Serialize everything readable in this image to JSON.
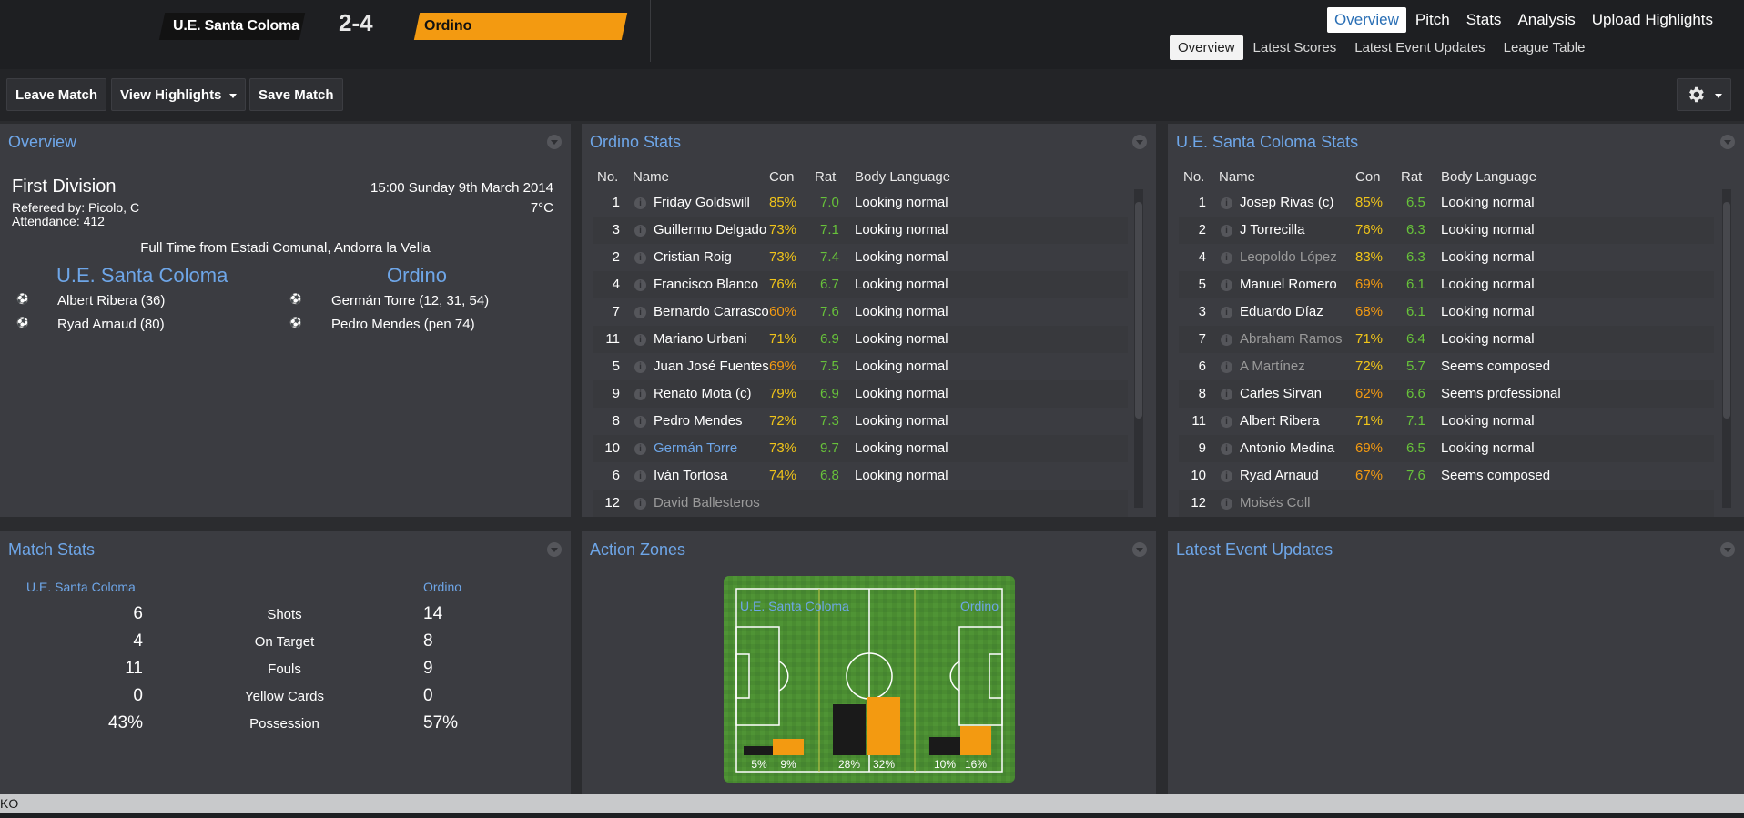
{
  "header": {
    "home_team": "U.E. Santa Coloma",
    "score": "2-4",
    "away_team": "Ordino",
    "away_color": "#f39a11",
    "main_tabs": [
      "Overview",
      "Pitch",
      "Stats",
      "Analysis",
      "Upload Highlights"
    ],
    "sub_tabs": [
      "Overview",
      "Latest Scores",
      "Latest Event Updates",
      "League Table"
    ]
  },
  "toolbar": {
    "leave": "Leave Match",
    "highlights": "View Highlights",
    "save": "Save Match",
    "gear_icon": "gear-icon"
  },
  "overview": {
    "title": "Overview",
    "competition": "First Division",
    "datetime": "15:00 Sunday 9th March 2014",
    "referee": "Refereed by: Picolo, C",
    "temperature": "7°C",
    "attendance": "Attendance: 412",
    "venue": "Full Time from Estadi Comunal, Andorra la Vella",
    "home": "U.E. Santa Coloma",
    "away": "Ordino",
    "home_scorers": [
      "Albert Ribera (36)",
      "Ryad Arnaud (80)"
    ],
    "away_scorers": [
      "Germán Torre (12, 31, 54)",
      "Pedro Mendes (pen 74)"
    ]
  },
  "ordino_stats": {
    "title": "Ordino Stats",
    "headers": [
      "No.",
      "Name",
      "Con",
      "Rat",
      "Body Language"
    ],
    "rows": [
      {
        "no": "1",
        "name": "Friday Goldswill",
        "con": "85%",
        "rat": "7.0",
        "body": "Looking normal",
        "con_c": "yellow"
      },
      {
        "no": "3",
        "name": "Guillermo Delgado",
        "con": "73%",
        "rat": "7.1",
        "body": "Looking normal",
        "con_c": "yellow"
      },
      {
        "no": "2",
        "name": "Cristian Roig",
        "con": "73%",
        "rat": "7.4",
        "body": "Looking normal",
        "con_c": "yellow"
      },
      {
        "no": "4",
        "name": "Francisco Blanco",
        "con": "76%",
        "rat": "6.7",
        "body": "Looking normal",
        "con_c": "yellow"
      },
      {
        "no": "7",
        "name": "Bernardo Carrasco",
        "con": "60%",
        "rat": "7.6",
        "body": "Looking normal",
        "con_c": "orange"
      },
      {
        "no": "11",
        "name": "Mariano Urbani",
        "con": "71%",
        "rat": "6.9",
        "body": "Looking normal",
        "con_c": "yellow"
      },
      {
        "no": "5",
        "name": "Juan José Fuentes",
        "con": "69%",
        "rat": "7.5",
        "body": "Looking normal",
        "con_c": "orange"
      },
      {
        "no": "9",
        "name": "Renato Mota (c)",
        "con": "79%",
        "rat": "6.9",
        "body": "Looking normal",
        "con_c": "yellow"
      },
      {
        "no": "8",
        "name": "Pedro Mendes",
        "con": "72%",
        "rat": "7.3",
        "body": "Looking normal",
        "con_c": "yellow"
      },
      {
        "no": "10",
        "name": "Germán Torre",
        "con": "73%",
        "rat": "9.7",
        "body": "Looking normal",
        "con_c": "yellow",
        "name_c": "blue"
      },
      {
        "no": "6",
        "name": "Iván Tortosa",
        "con": "74%",
        "rat": "6.8",
        "body": "Looking normal",
        "con_c": "yellow"
      },
      {
        "no": "12",
        "name": "David Ballesteros",
        "con": "",
        "rat": "",
        "body": "",
        "name_c": "dim"
      }
    ]
  },
  "usc_stats": {
    "title": "U.E. Santa Coloma Stats",
    "headers": [
      "No.",
      "Name",
      "Con",
      "Rat",
      "Body Language"
    ],
    "rows": [
      {
        "no": "1",
        "name": "Josep Rivas (c)",
        "con": "85%",
        "rat": "6.5",
        "body": "Looking normal",
        "con_c": "yellow"
      },
      {
        "no": "2",
        "name": "J Torrecilla",
        "con": "76%",
        "rat": "6.3",
        "body": "Looking normal",
        "con_c": "yellow"
      },
      {
        "no": "4",
        "name": "Leopoldo López",
        "con": "83%",
        "rat": "6.3",
        "body": "Looking normal",
        "con_c": "yellow",
        "name_c": "dim"
      },
      {
        "no": "5",
        "name": "Manuel Romero",
        "con": "69%",
        "rat": "6.1",
        "body": "Looking normal",
        "con_c": "orange"
      },
      {
        "no": "3",
        "name": "Eduardo Díaz",
        "con": "68%",
        "rat": "6.1",
        "body": "Looking normal",
        "con_c": "orange"
      },
      {
        "no": "7",
        "name": "Abraham Ramos",
        "con": "71%",
        "rat": "6.4",
        "body": "Looking normal",
        "con_c": "yellow",
        "name_c": "dim"
      },
      {
        "no": "6",
        "name": "A Martínez",
        "con": "72%",
        "rat": "5.7",
        "body": "Seems composed",
        "con_c": "yellow",
        "name_c": "dim"
      },
      {
        "no": "8",
        "name": "Carles Sirvan",
        "con": "62%",
        "rat": "6.6",
        "body": "Seems professional",
        "con_c": "orange"
      },
      {
        "no": "11",
        "name": "Albert Ribera",
        "con": "71%",
        "rat": "7.1",
        "body": "Looking normal",
        "con_c": "yellow"
      },
      {
        "no": "9",
        "name": "Antonio Medina",
        "con": "69%",
        "rat": "6.5",
        "body": "Looking normal",
        "con_c": "orange"
      },
      {
        "no": "10",
        "name": "Ryad Arnaud",
        "con": "67%",
        "rat": "7.6",
        "body": "Seems composed",
        "con_c": "orange"
      },
      {
        "no": "12",
        "name": "Moisés Coll",
        "con": "",
        "rat": "",
        "body": "",
        "name_c": "dim"
      }
    ]
  },
  "match_stats": {
    "title": "Match Stats",
    "home": "U.E. Santa Coloma",
    "away": "Ordino",
    "rows": [
      {
        "label": "Shots",
        "home": "6",
        "away": "14"
      },
      {
        "label": "On Target",
        "home": "4",
        "away": "8"
      },
      {
        "label": "Fouls",
        "home": "11",
        "away": "9"
      },
      {
        "label": "Yellow Cards",
        "home": "0",
        "away": "0"
      },
      {
        "label": "Possession",
        "home": "43%",
        "away": "57%"
      }
    ]
  },
  "action_zones": {
    "title": "Action Zones",
    "home_label": "U.E. Santa Coloma",
    "away_label": "Ordino",
    "zones": [
      {
        "home": 5,
        "away": 9,
        "home_label": "5%",
        "away_label": "9%"
      },
      {
        "home": 28,
        "away": 32,
        "home_label": "28%",
        "away_label": "32%"
      },
      {
        "home": 10,
        "away": 16,
        "home_label": "10%",
        "away_label": "16%"
      }
    ]
  },
  "latest_events": {
    "title": "Latest Event Updates"
  },
  "status": {
    "text": "KO"
  }
}
